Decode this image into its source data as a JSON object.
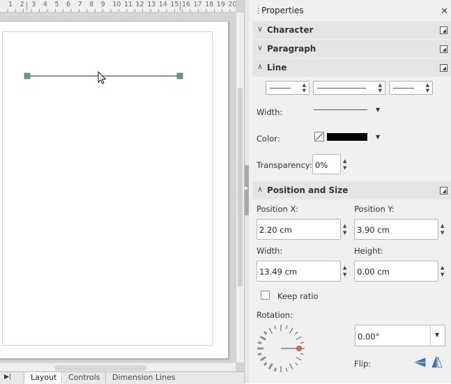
{
  "ruler": {
    "numbers": [
      "1",
      "2",
      "3",
      "4",
      "5",
      "6",
      "7",
      "8",
      "9",
      "10",
      "11",
      "12",
      "13",
      "14",
      "15",
      "16",
      "17",
      "18",
      "19",
      "20"
    ]
  },
  "sheet_tabs": {
    "nav": "▶|",
    "tabs": [
      "Layout",
      "Controls",
      "Dimension Lines"
    ],
    "active": "Layout"
  },
  "panel": {
    "title": "Properties",
    "grip": "⋮",
    "close": "✕",
    "sections": {
      "character": "Character",
      "paragraph": "Paragraph",
      "line": "Line",
      "position": "Position and Size"
    },
    "line": {
      "width_label": "Width:",
      "color_label": "Color:",
      "color_value": "#000000",
      "transparency_label": "Transparency:",
      "transparency_value": "0%"
    },
    "position": {
      "pos_x_label": "Position X:",
      "pos_x_value": "2.20 cm",
      "pos_y_label": "Position Y:",
      "pos_y_value": "3.90 cm",
      "width_label": "Width:",
      "width_value": "13.49 cm",
      "height_label": "Height:",
      "height_value": "0.00 cm",
      "keep_ratio_label": "Keep ratio",
      "keep_ratio_checked": false,
      "rotation_label": "Rotation:",
      "rotation_value": "0.00°",
      "flip_label": "Flip:"
    }
  },
  "colors": {
    "accent_handle": "#6a9a8a",
    "rotation_knob": "#e07040",
    "panel_bg": "#f0f0f0",
    "section_bg": "#e5e5e5"
  },
  "icons": [
    "close-icon",
    "more-options-icon",
    "chevron-icon",
    "flip-vertical-icon",
    "flip-horizontal-icon",
    "mouse-cursor-icon"
  ]
}
